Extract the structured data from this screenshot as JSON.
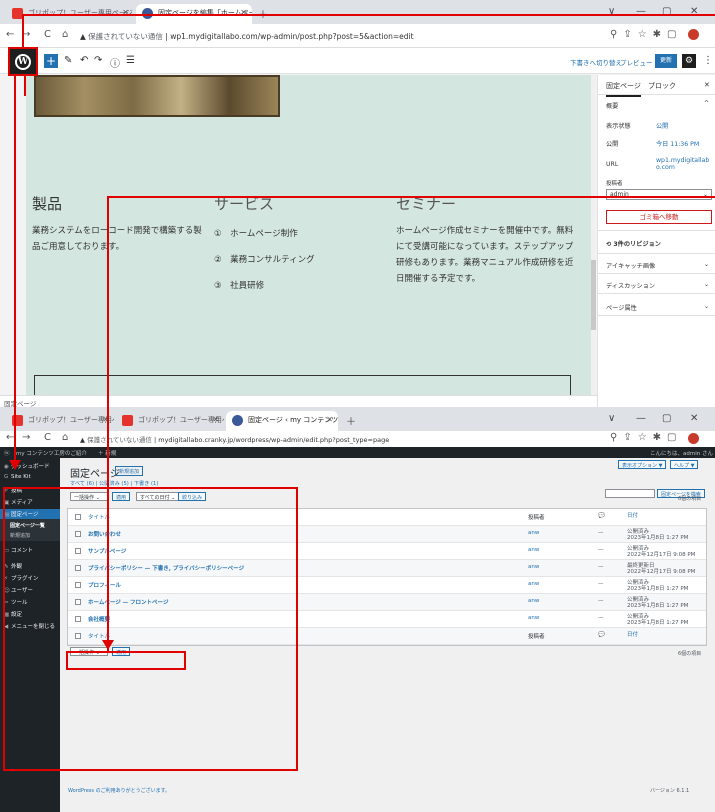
{
  "top_window": {
    "tabs": [
      {
        "label": "ゴリポップ！ユーザー専用ページ - Wo"
      },
      {
        "label": "固定ページを編集「ホームページ」"
      }
    ],
    "window_controls": [
      "∨",
      "—",
      "▢",
      "✕"
    ],
    "address": {
      "warning": "保護されていない通信",
      "url": "wp1.mydigitallabo.com/wp-admin/post.php?post=5&action=edit"
    },
    "toolbar": {
      "switch_draft": "下書きへ切り替え",
      "preview": "プレビュー",
      "update": "更新"
    },
    "content": {
      "col1_heading": "製品",
      "col1_text": "業務システムをローコード開発で構築する製品ご用意しております。",
      "col2_heading": "サービス",
      "services": [
        "①　ホームページ制作",
        "②　業務コンサルティング",
        "③　社員研修"
      ],
      "col3_heading": "セミナー",
      "col3_text": "ホームページ作成セミナーを開催中です。無料にて受講可能になっています。ステップアップ研修もあります。業務マニュアル作成研修を近日開催する予定です。"
    },
    "status_label": "固定ページ",
    "sidebar": {
      "tab_page": "固定ページ",
      "tab_block": "ブロック",
      "summary": "概要",
      "visibility_label": "表示状態",
      "visibility_value": "公開",
      "publish_label": "公開",
      "publish_value": "今日 11:36 PM",
      "url_label": "URL",
      "url_value": "wp1.mydigitallabo.com",
      "author_label": "投稿者",
      "author_value": "admin",
      "trash": "ゴミ箱へ移動",
      "revisions": "3件のリビジョン",
      "featured_image": "アイキャッチ画像",
      "discussion": "ディスカッション",
      "page_attributes": "ページ属性"
    }
  },
  "bottom_window": {
    "tabs": [
      {
        "label": "ゴリポップ！ユーザー専用ページ - Wo"
      },
      {
        "label": "ゴリポップ！ユーザー専用ページ - Wo"
      },
      {
        "label": "固定ページ ‹ my コンテンツ工房のご"
      }
    ],
    "address": {
      "warning": "保護されていない通信",
      "url": "mydigitallabo.cranky.jp/wordpress/wp-admin/edit.php?post_type=page"
    },
    "admin_bar": {
      "site": "my コンテンツ工房のご紹介",
      "new": "＋ 新規",
      "howdy": "こんにちは、admin さん"
    },
    "menu": [
      "ダッシュボード",
      "Site Kit",
      "投稿",
      "メディア",
      "固定ページ",
      "コメント",
      "外観",
      "プラグイン",
      "ユーザー",
      "ツール",
      "設定",
      "メニューを閉じる"
    ],
    "submenu": [
      "固定ページ一覧",
      "新規追加"
    ],
    "page_title": "固定ページ",
    "new_button": "新規追加",
    "screen_options": "表示オプション ▼",
    "help": "ヘルプ ▼",
    "filters": "すべて (6) | 公開済み (5) | 下書き (1)",
    "bulk_action": "一括操作",
    "apply": "適用",
    "all_dates": "すべての日付",
    "filter_btn": "絞り込み",
    "search_btn": "固定ページを検索",
    "items_count": "6個の項目",
    "table": {
      "headers": {
        "title": "タイトル",
        "author": "投稿者",
        "comment": "💬",
        "date": "日付"
      },
      "rows": [
        {
          "title": "お問い合わせ",
          "author": "anw",
          "comment": "—",
          "status": "公開済み",
          "date": "2023年1月8日 1:27 PM"
        },
        {
          "title": "サンプルページ",
          "author": "anw",
          "comment": "—",
          "status": "公開済み",
          "date": "2022年12月17日 9:08 PM"
        },
        {
          "title": "プライバシーポリシー — 下書き, プライバシーポリシーページ",
          "author": "anw",
          "comment": "—",
          "status": "最終更新日",
          "date": "2022年12月17日 9:08 PM"
        },
        {
          "title": "プロフィール",
          "author": "anw",
          "comment": "—",
          "status": "公開済み",
          "date": "2023年1月8日 1:27 PM"
        },
        {
          "title": "ホームページ — フロントページ",
          "author": "anw",
          "comment": "—",
          "status": "公開済み",
          "date": "2023年1月8日 1:27 PM"
        },
        {
          "title": "会社概要",
          "author": "anw",
          "comment": "—",
          "status": "公開済み",
          "date": "2023年1月8日 1:27 PM"
        }
      ]
    },
    "footer": "WordPress のご利用ありがとうございます。",
    "version": "バージョン 6.1.1"
  },
  "colors": {
    "annotation": "#e00000",
    "wp_blue": "#2271b1",
    "admin_dark": "#1d2327",
    "canvas_bg": "#d4e6e0"
  }
}
